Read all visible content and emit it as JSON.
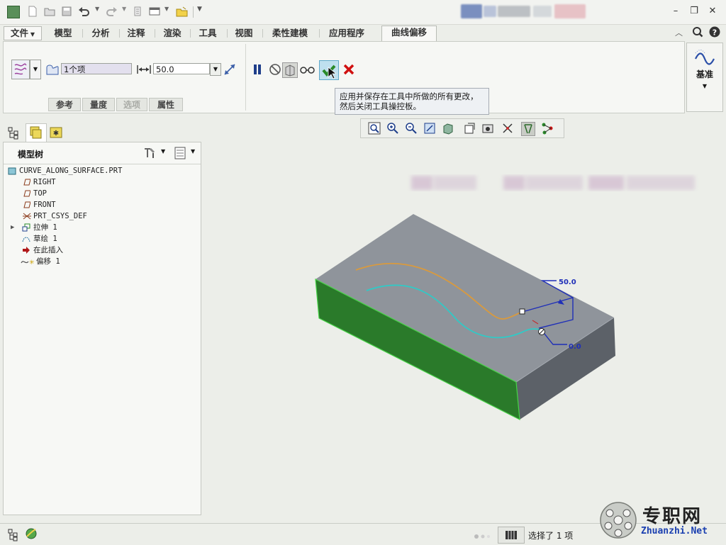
{
  "ribbon": {
    "file_tab": "文件",
    "tabs": [
      "模型",
      "分析",
      "注释",
      "渲染",
      "工具",
      "视图",
      "柔性建模",
      "应用程序"
    ],
    "active_tab": "曲线偏移"
  },
  "dashboard": {
    "reference_value": "1个项",
    "offset_value": "50.0",
    "subtabs": [
      "参考",
      "量度",
      "选项",
      "属性"
    ]
  },
  "tooltip": {
    "line1": "应用并保存在工具中所做的所有更改，",
    "line2": "然后关闭工具操控板。"
  },
  "datum": {
    "label": "基准"
  },
  "model_tree": {
    "title": "模型树",
    "items": [
      {
        "label": "CURVE_ALONG_SURFACE.PRT",
        "icon": "part-icon"
      },
      {
        "label": "RIGHT",
        "icon": "datum-plane-icon"
      },
      {
        "label": "TOP",
        "icon": "datum-plane-icon"
      },
      {
        "label": "FRONT",
        "icon": "datum-plane-icon"
      },
      {
        "label": "PRT_CSYS_DEF",
        "icon": "csys-icon"
      },
      {
        "label": "拉伸 1",
        "icon": "extrude-icon"
      },
      {
        "label": "草绘 1",
        "icon": "sketch-icon"
      },
      {
        "label": "在此插入",
        "icon": "insert-arrow-icon"
      },
      {
        "label": "偏移 1",
        "icon": "offset-icon"
      }
    ]
  },
  "viewport": {
    "dim_offset": "50.0",
    "dim_start": "0.0"
  },
  "status": {
    "selection": "选择了 1 项"
  },
  "watermark": {
    "cn": "专职网",
    "url": "Zhuanzhi.Net"
  },
  "colors": {
    "accent_green": "#2a8a2a",
    "cancel_red": "#d01010",
    "model_top": "#8f949b",
    "model_side": "#2a7a2a",
    "dimension_blue": "#1f2fb8"
  }
}
